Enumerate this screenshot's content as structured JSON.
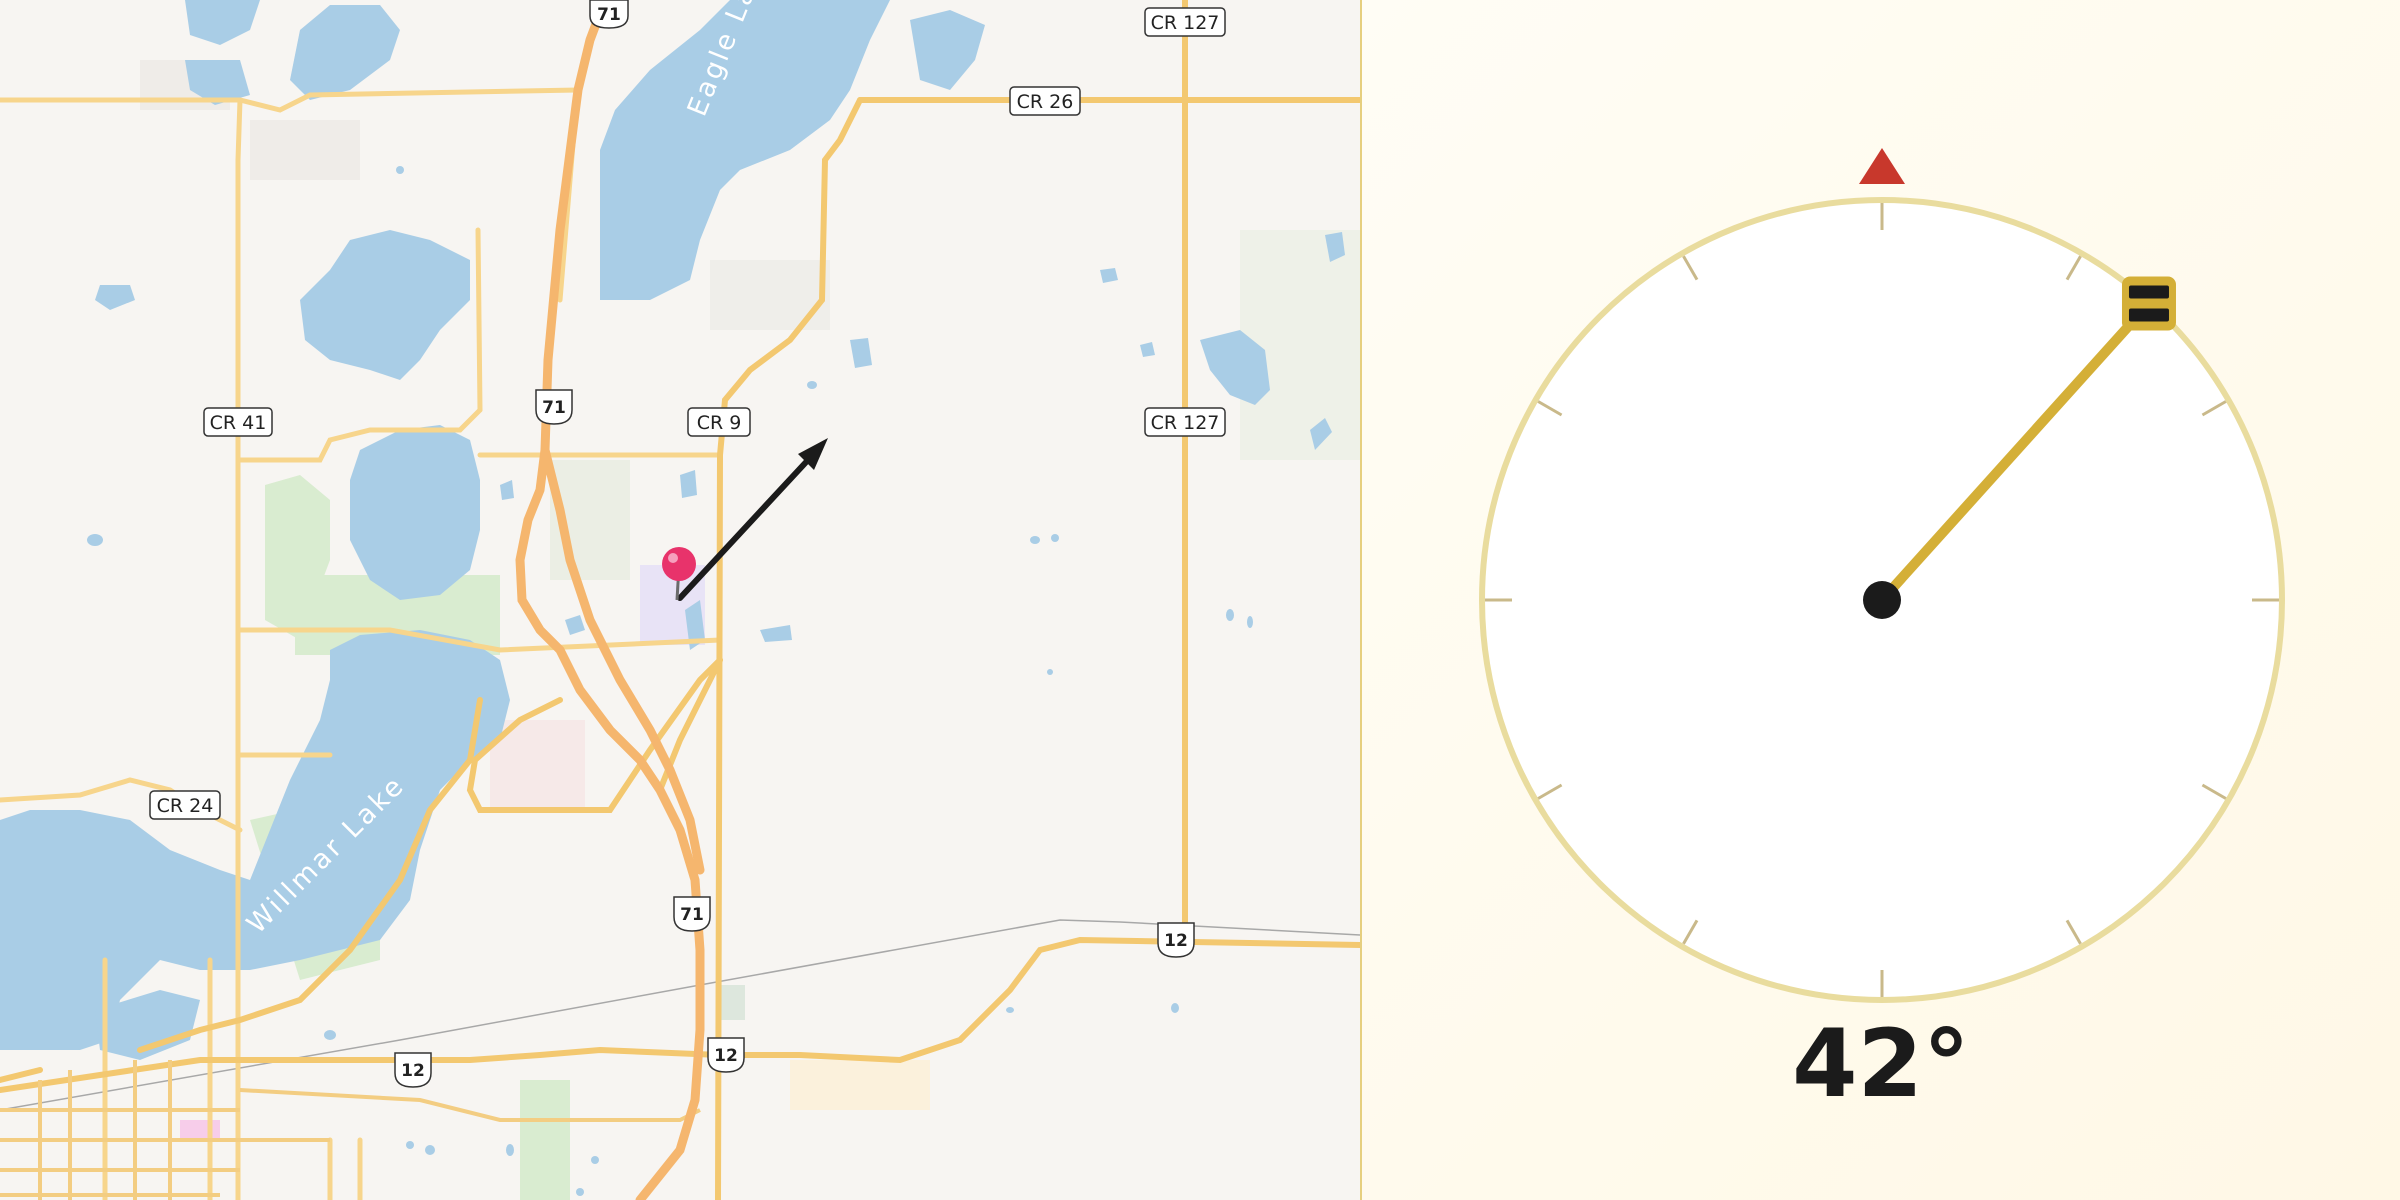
{
  "map": {
    "road_labels": {
      "cr127_top": "CR 127",
      "cr26": "CR 26",
      "cr41": "CR 41",
      "cr9": "CR 9",
      "cr127_mid": "CR 127",
      "cr24": "CR 24"
    },
    "route_shields": {
      "us71_top": "71",
      "us71_mid": "71",
      "us71_bottom": "71",
      "us12_right": "12",
      "us12_mid": "12",
      "us12_left": "12"
    },
    "water_labels": {
      "eagle_lake": "Eagle Lake",
      "willmar_lake": "Willmar Lake"
    },
    "marker": {
      "icon": "map-pin-icon",
      "color": "#e8336b"
    },
    "direction_arrow": {
      "icon": "arrow-icon",
      "color": "#1b1b1b"
    }
  },
  "compass": {
    "heading_degrees": 42,
    "heading_label": "42°",
    "north_marker_color": "#c8382c",
    "needle_color": "#d4af37",
    "handle_icon": "needle-handle-icon"
  }
}
